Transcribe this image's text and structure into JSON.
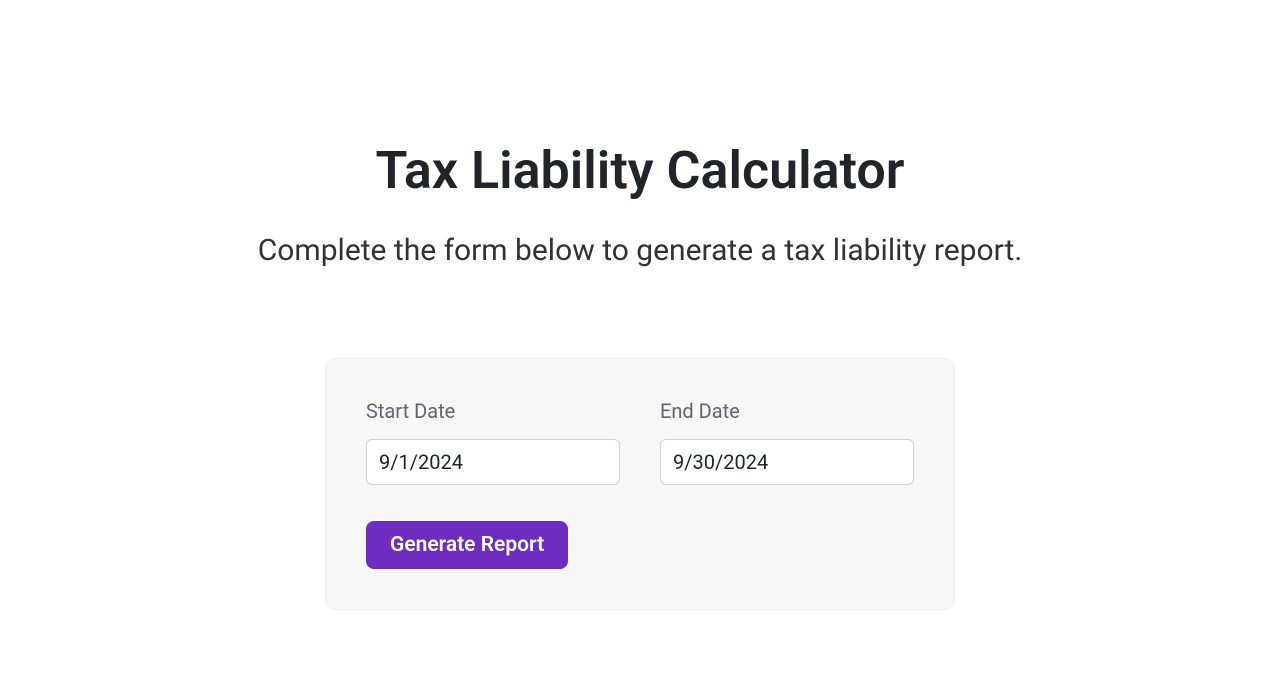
{
  "header": {
    "title": "Tax Liability Calculator",
    "subtitle": "Complete the form below to generate a tax liability report."
  },
  "form": {
    "startDate": {
      "label": "Start Date",
      "value": "9/1/2024"
    },
    "endDate": {
      "label": "End Date",
      "value": "9/30/2024"
    },
    "submitLabel": "Generate Report"
  }
}
